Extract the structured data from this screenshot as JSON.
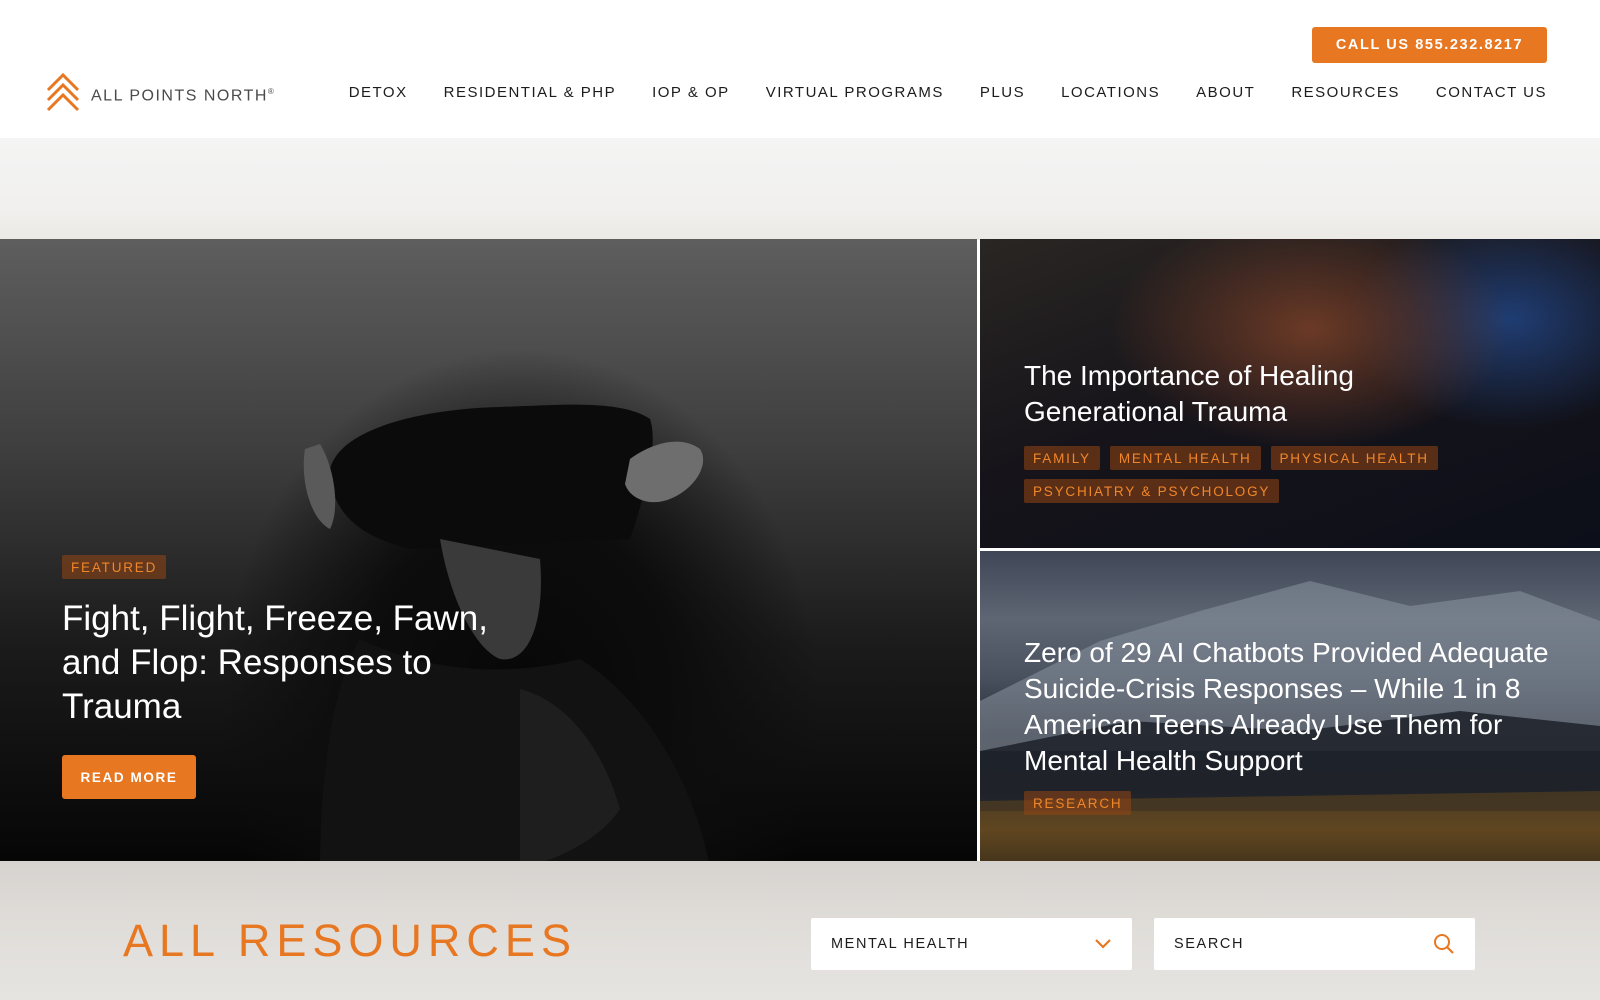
{
  "brand": {
    "name": "ALL POINTS NORTH",
    "trademark": "®",
    "accent": "#e87722"
  },
  "header": {
    "call_label": "CALL US 855.232.8217",
    "nav": [
      "DETOX",
      "RESIDENTIAL & PHP",
      "IOP & OP",
      "VIRTUAL PROGRAMS",
      "PLUS",
      "LOCATIONS",
      "ABOUT",
      "RESOURCES",
      "CONTACT US"
    ]
  },
  "featured": {
    "tag": "FEATURED",
    "title": "Fight, Flight, Freeze, Fawn, and Flop: Responses to Trauma",
    "button_label": "READ MORE"
  },
  "cards": [
    {
      "title": "The Importance of Healing Generational Trauma",
      "tags": [
        "FAMILY",
        "MENTAL HEALTH",
        "PHYSICAL HEALTH",
        "PSYCHIATRY & PSYCHOLOGY"
      ]
    },
    {
      "title": "Zero of 29 AI Chatbots Provided Adequate Suicide-Crisis Responses – While 1 in 8 American Teens Already Use Them for Mental Health Support",
      "tags": [
        "RESEARCH"
      ]
    }
  ],
  "resources": {
    "title": "ALL RESOURCES",
    "filter_value": "MENTAL HEALTH",
    "search_placeholder": "SEARCH"
  }
}
